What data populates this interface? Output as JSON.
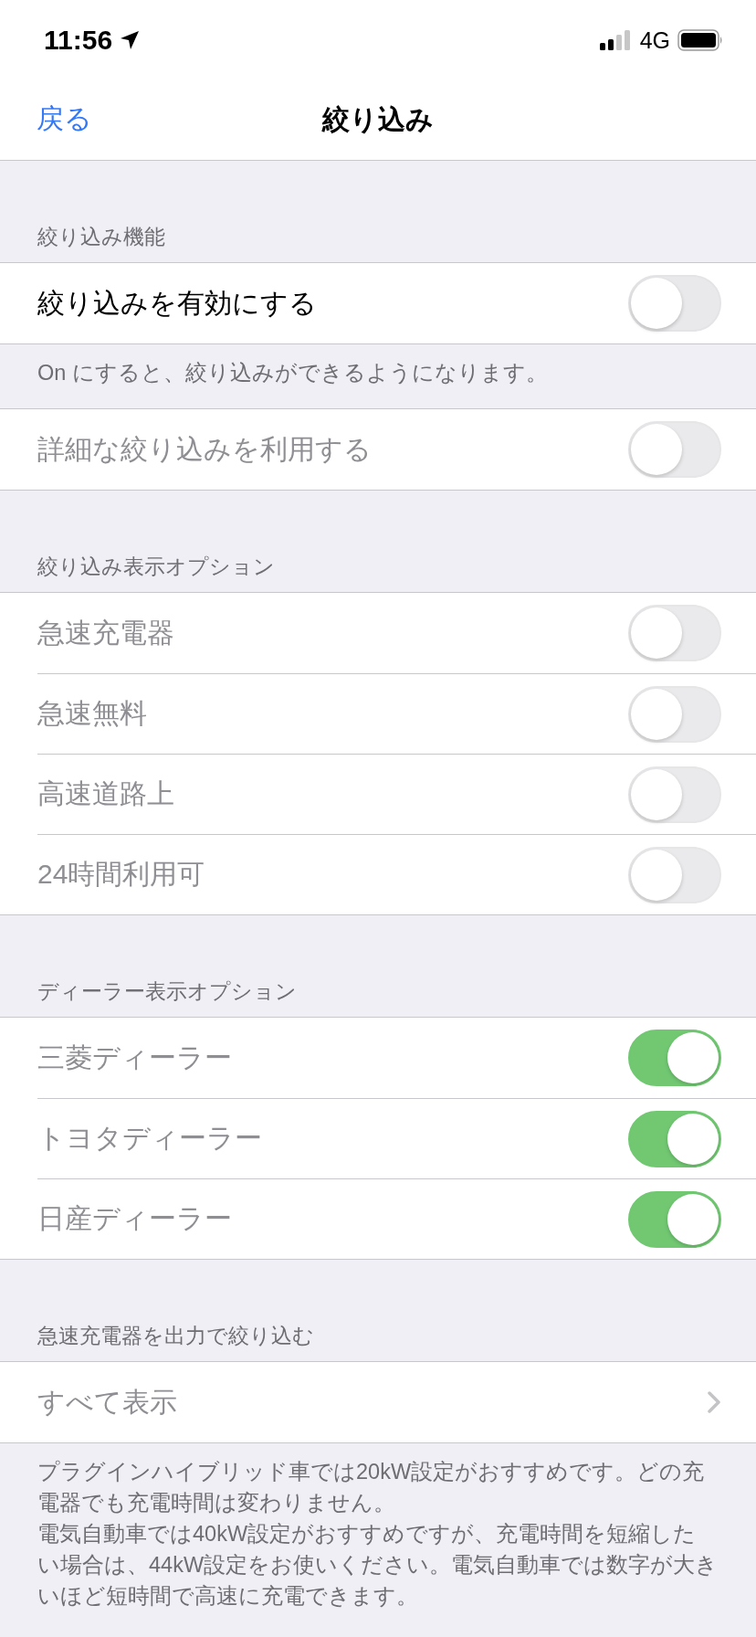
{
  "status_bar": {
    "time": "11:56",
    "network": "4G"
  },
  "nav": {
    "back": "戻る",
    "title": "絞り込み"
  },
  "sections": [
    {
      "header": "絞り込み機能",
      "rows": [
        {
          "kind": "toggle",
          "label": "絞り込みを有効にする",
          "on": false,
          "disabled": false
        }
      ],
      "footer": [
        "On にすると、絞り込みができるようになります。"
      ]
    },
    {
      "rows": [
        {
          "kind": "toggle",
          "label": "詳細な絞り込みを利用する",
          "on": false,
          "disabled": true
        }
      ]
    },
    {
      "header": "絞り込み表示オプション",
      "rows": [
        {
          "kind": "toggle",
          "label": "急速充電器",
          "on": false,
          "disabled": true
        },
        {
          "kind": "toggle",
          "label": "急速無料",
          "on": false,
          "disabled": true
        },
        {
          "kind": "toggle",
          "label": "高速道路上",
          "on": false,
          "disabled": true
        },
        {
          "kind": "toggle",
          "label": "24時間利用可",
          "on": false,
          "disabled": true
        }
      ]
    },
    {
      "header": "ディーラー表示オプション",
      "rows": [
        {
          "kind": "toggle",
          "label": "三菱ディーラー",
          "on": true,
          "disabled": true
        },
        {
          "kind": "toggle",
          "label": "トヨタディーラー",
          "on": true,
          "disabled": true
        },
        {
          "kind": "toggle",
          "label": "日産ディーラー",
          "on": true,
          "disabled": true
        }
      ]
    },
    {
      "header": "急速充電器を出力で絞り込む",
      "rows": [
        {
          "kind": "disclosure",
          "label": "すべて表示",
          "disabled": true
        }
      ],
      "footer": [
        "プラグインハイブリッド車では20kW設定がおすすめです。どの充電器でも充電時間は変わりません。",
        "電気自動車では40kW設定がおすすめですが、充電時間を短縮したい場合は、44kW設定をお使いください。電気自動車では数字が大きいほど短時間で高速に充電できます。"
      ]
    }
  ]
}
